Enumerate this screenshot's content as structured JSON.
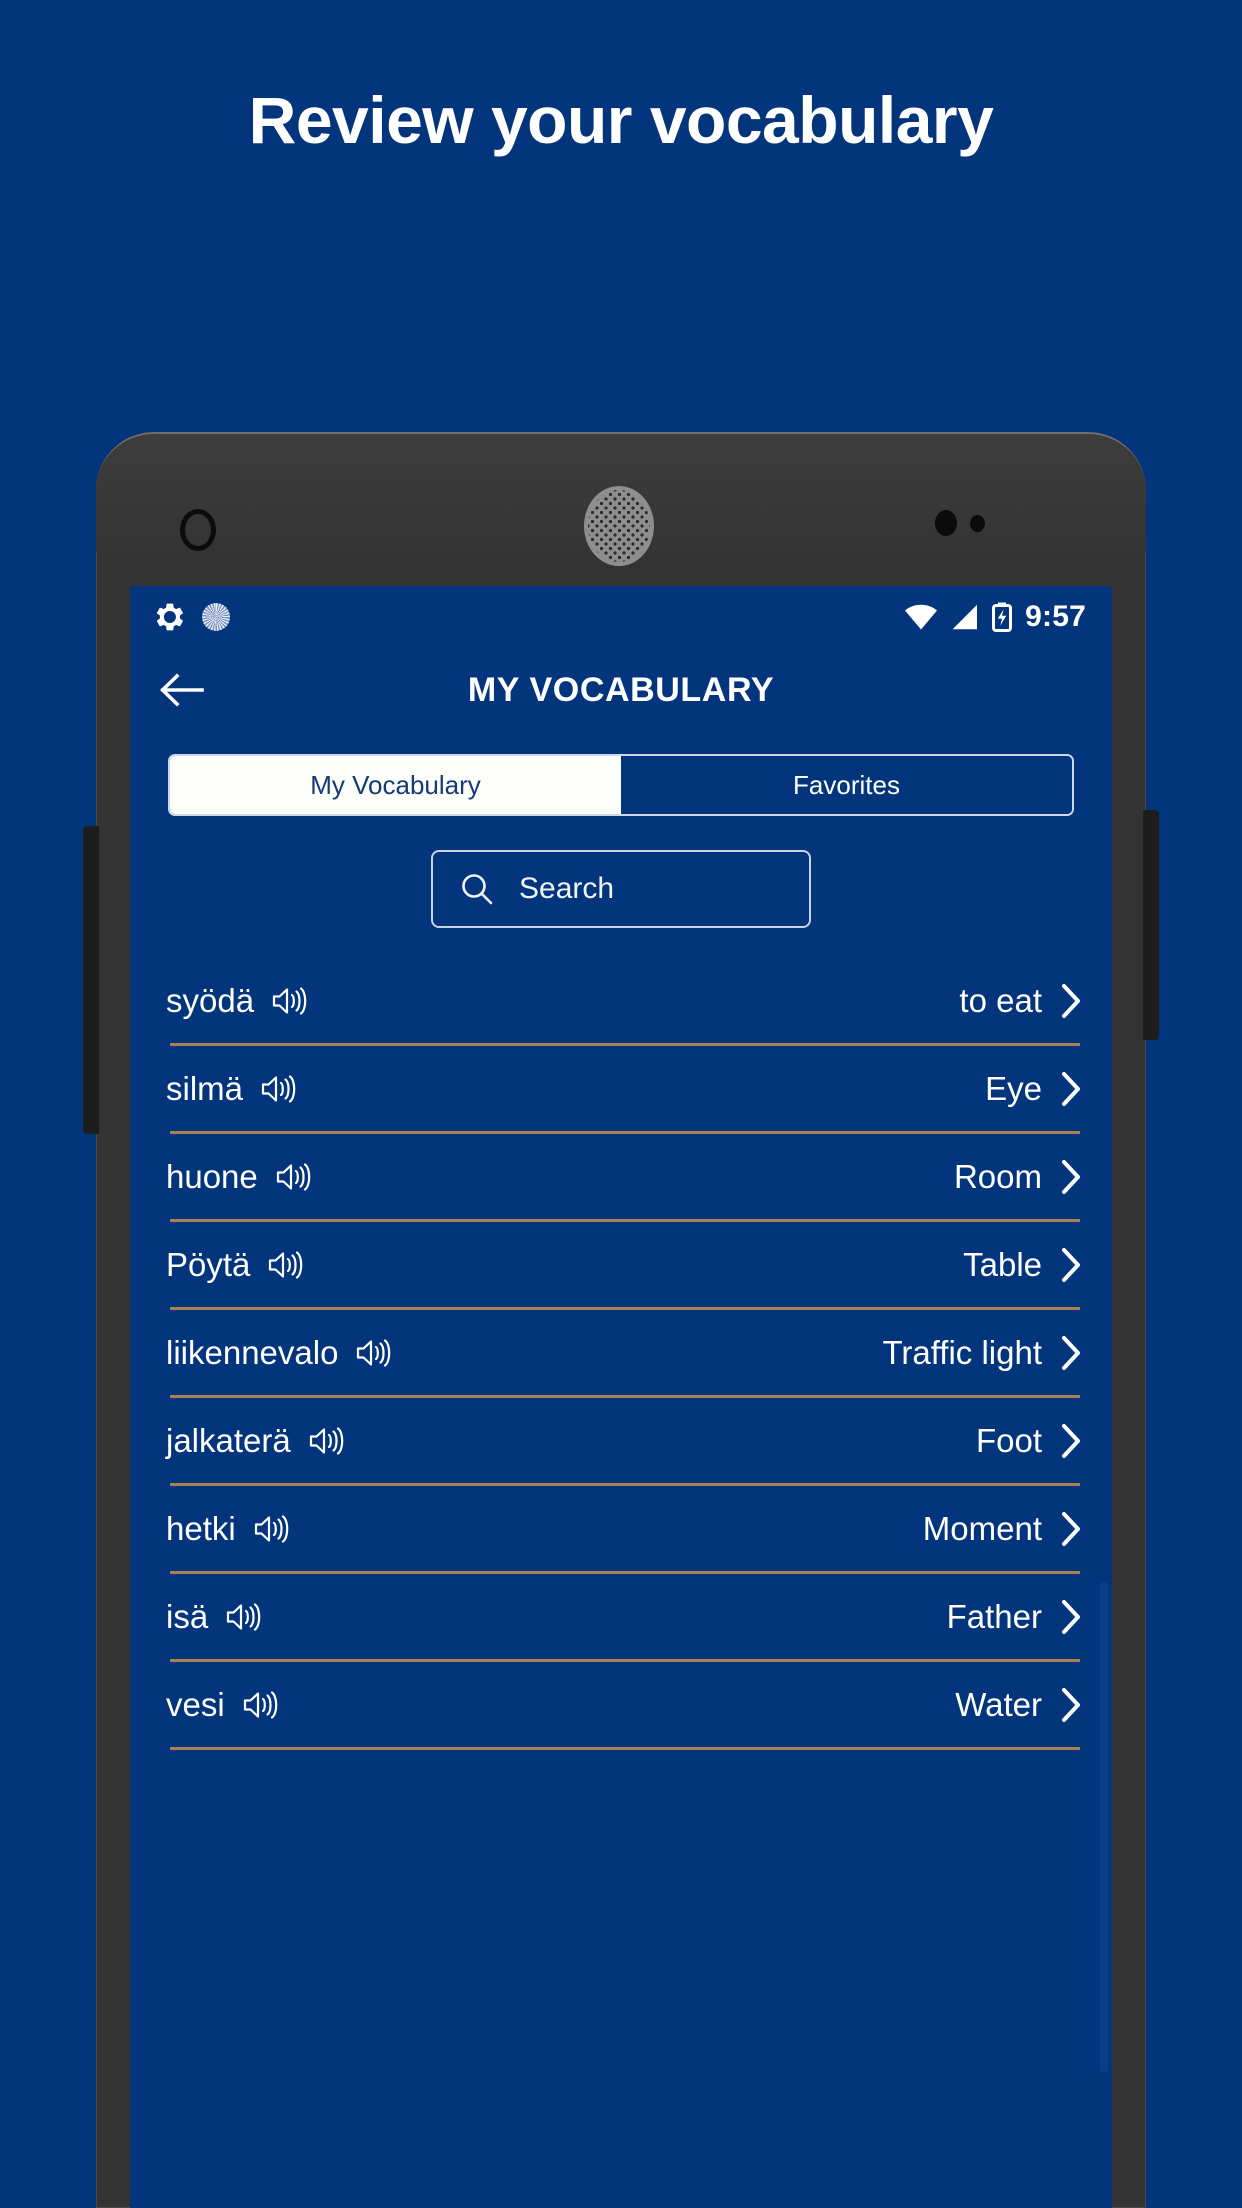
{
  "promo": {
    "headline": "Review your vocabulary"
  },
  "colors": {
    "background": "#03357d",
    "accent_divider": "#a8824f",
    "tab_active_bg": "#fdfdfa",
    "tab_active_text": "#143a77",
    "text_primary": "#ffffff",
    "phone_bezel": "#333333"
  },
  "phone": {
    "camera_icon": "front-camera-icon",
    "speaker_icon": "earpiece-speaker-icon",
    "sensor_icon": "proximity-sensor-icon",
    "volume_button": "volume-rocker",
    "power_button": "power-button"
  },
  "status_bar": {
    "icons_left": [
      "gear-icon",
      "sync-spinner-icon"
    ],
    "icons_right": [
      "wifi-icon",
      "cellular-signal-icon",
      "battery-charging-icon"
    ],
    "time": "9:57"
  },
  "app_bar": {
    "back_icon": "back-arrow-icon",
    "title": "MY VOCABULARY"
  },
  "tabs": [
    {
      "label": "My Vocabulary",
      "active": true
    },
    {
      "label": "Favorites",
      "active": false
    }
  ],
  "search": {
    "icon": "search-icon",
    "placeholder": "Search",
    "value": ""
  },
  "vocabulary": {
    "speaker_icon": "speaker-volume-icon",
    "chevron_icon": "chevron-right-icon",
    "rows": [
      {
        "term": "syödä",
        "translation": "to eat"
      },
      {
        "term": "silmä",
        "translation": "Eye"
      },
      {
        "term": "huone",
        "translation": "Room"
      },
      {
        "term": "Pöytä",
        "translation": "Table"
      },
      {
        "term": "liikennevalo",
        "translation": "Traffic light"
      },
      {
        "term": "jalkaterä",
        "translation": "Foot"
      },
      {
        "term": "hetki",
        "translation": "Moment"
      },
      {
        "term": "isä",
        "translation": "Father"
      },
      {
        "term": "vesi",
        "translation": "Water"
      }
    ]
  }
}
